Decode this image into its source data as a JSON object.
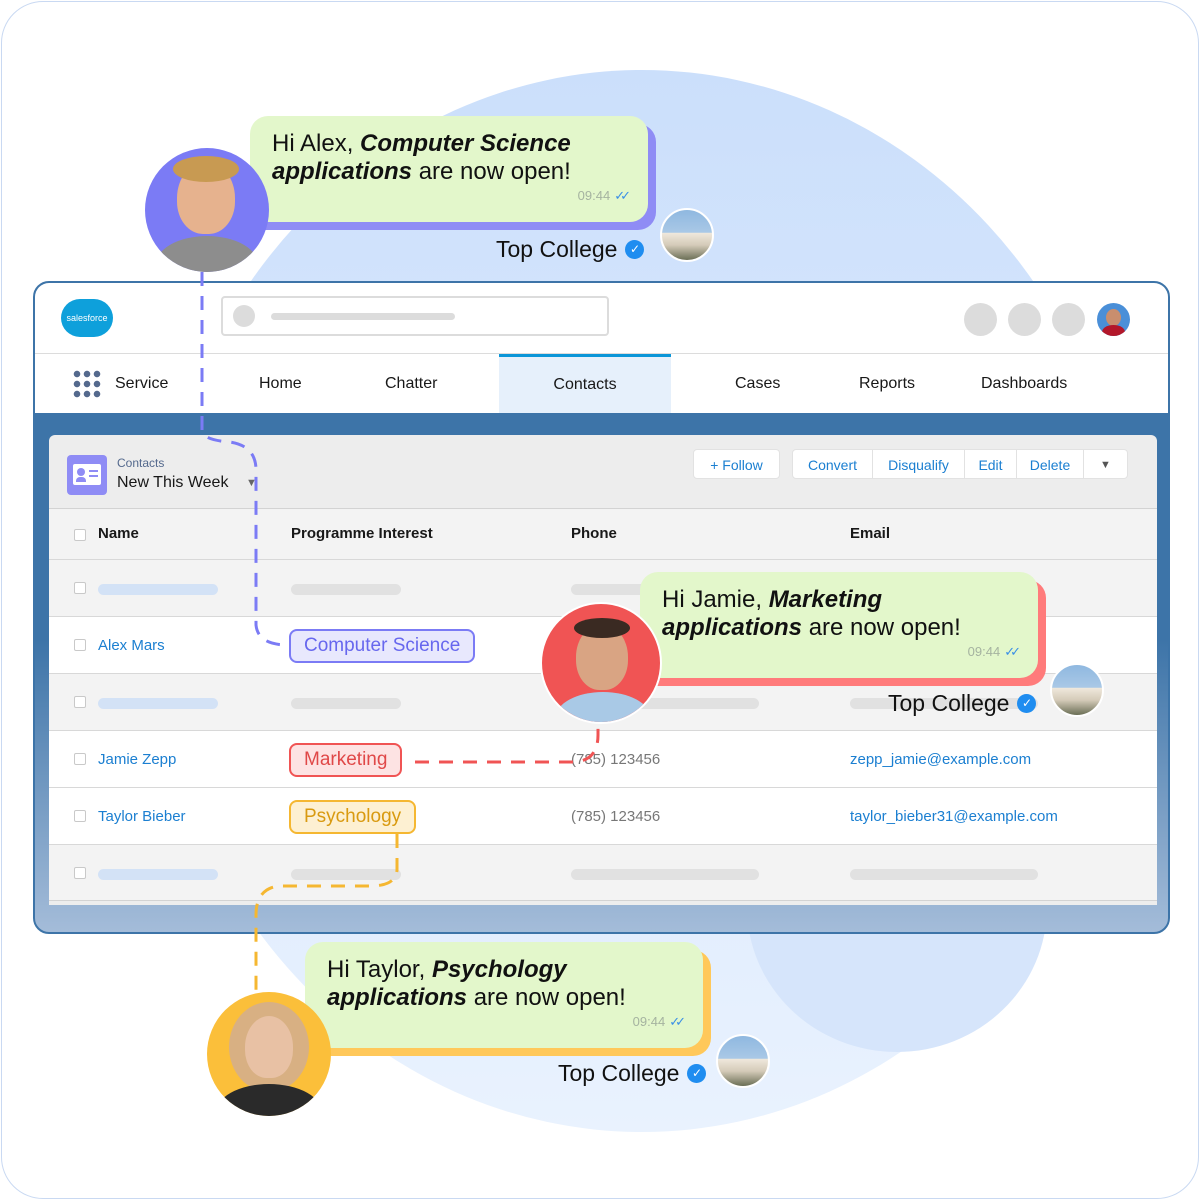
{
  "app": {
    "logo_text": "salesforce",
    "app_name": "Service"
  },
  "nav": {
    "items": [
      "Home",
      "Chatter",
      "Contacts",
      "Cases",
      "Reports",
      "Dashboards"
    ],
    "active": "Contacts"
  },
  "list": {
    "object_label": "Contacts",
    "view_name": "New This Week"
  },
  "actions": {
    "follow": "Follow",
    "convert": "Convert",
    "disqualify": "Disqualify",
    "edit": "Edit",
    "delete": "Delete"
  },
  "table": {
    "headers": [
      "Name",
      "Programme Interest",
      "Phone",
      "Email"
    ],
    "rows": [
      {
        "name": "Alex Mars",
        "programme": "Computer Science",
        "phone": "",
        "email": ""
      },
      {
        "name": "Jamie Zepp",
        "programme": "Marketing",
        "phone": "(785) 123456",
        "email": "zepp_jamie@example.com"
      },
      {
        "name": "Taylor Bieber",
        "programme": "Psychology",
        "phone": "(785) 123456",
        "email": "taylor_bieber31@example.com"
      }
    ]
  },
  "messages": [
    {
      "greeting": "Hi Alex, ",
      "bold": "Computer Science applications",
      "rest": " are now open!",
      "time": "09:44",
      "sender": "Top College",
      "accent": "#8f8cf5"
    },
    {
      "greeting": "Hi Jamie, ",
      "bold": "Marketing applications",
      "rest": " are now open!",
      "time": "09:44",
      "sender": "Top College",
      "accent": "#ff7b7b"
    },
    {
      "greeting": "Hi Taylor, ",
      "bold": "Psychology applications",
      "rest": " are now open!",
      "time": "09:44",
      "sender": "Top College",
      "accent": "#ffc85a"
    }
  ],
  "colors": {
    "brand_blue": "#3d74a8",
    "link": "#1b7fd1",
    "cs": "#7b7bf5",
    "marketing": "#f05454",
    "psychology": "#f5b731"
  }
}
